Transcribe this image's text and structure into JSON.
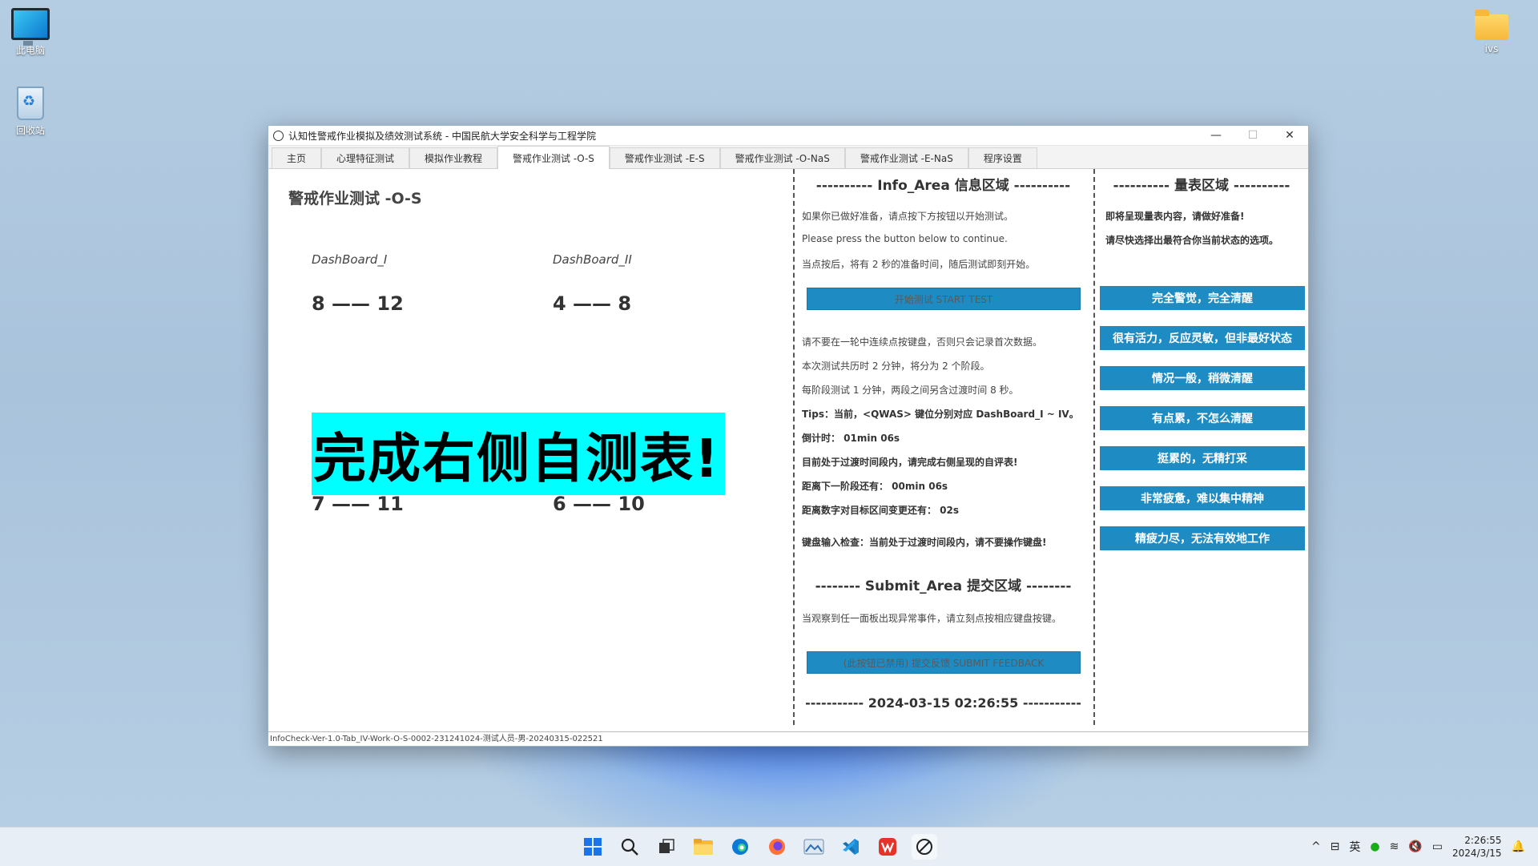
{
  "desktop": {
    "icons": [
      {
        "label": "此电脑"
      },
      {
        "label": "回收站"
      },
      {
        "label": "ivs"
      }
    ]
  },
  "window": {
    "title": "认知性警戒作业模拟及绩效测试系统 - 中国民航大学安全科学与工程学院",
    "controls": {
      "minimize": "—",
      "maximize": "☐",
      "close": "✕"
    },
    "tabs": [
      "主页",
      "心理特征测试",
      "模拟作业教程",
      "警戒作业测试 -O-S",
      "警戒作业测试 -E-S",
      "警戒作业测试 -O-NaS",
      "警戒作业测试 -E-NaS",
      "程序设置"
    ],
    "active_tab": 3
  },
  "left": {
    "title": "警戒作业测试 -O-S",
    "dashboards": [
      {
        "label": "DashBoard_I",
        "range": "8 —— 12"
      },
      {
        "label": "DashBoard_II",
        "range": "4 —— 8"
      },
      {
        "range": "7 —— 11"
      },
      {
        "range": "6 —— 10"
      }
    ],
    "banner": "完成右侧自测表!",
    "banner_color": "#00ffff"
  },
  "info": {
    "header": "---------- Info_Area  信息区域 ----------",
    "intro": [
      "如果你已做好准备，请点按下方按钮以开始测试。",
      "Please press the button below to continue.",
      "当点按后，将有 2 秒的准备时间，随后测试即刻开始。"
    ],
    "start_button": "开始测试 START TEST",
    "notes": [
      "请不要在一轮中连续点按键盘，否则只会记录首次数据。",
      "本次测试共历时 2 分钟，将分为 2 个阶段。",
      "每阶段测试 1 分钟，两段之间另含过渡时间 8 秒。"
    ],
    "tips": "Tips：当前，<QWAS> 键位分别对应 DashBoard_I ~ IV。",
    "countdown": "倒计时：  01min 06s",
    "transition": "目前处于过渡时间段内，请完成右侧呈现的自评表!",
    "next_stage": "距离下一阶段还有：  00min 06s",
    "interval_change": "距离数字对目标区间变更还有：   02s",
    "keyboard_check": "键盘输入检查：当前处于过渡时间段内，请不要操作键盘!",
    "submit_header": "-------- Submit_Area  提交区域 --------",
    "submit_hint": "当观察到任一面板出现异常事件，请立刻点按相应键盘按键。",
    "submit_button": "(此按钮已禁用) 提交反馈 SUBMIT FEEDBACK",
    "datetime": "----------- 2024-03-15 02:26:55 -----------"
  },
  "scale": {
    "header": "---------- 量表区域 ----------",
    "intro": [
      "即将呈现量表内容，请做好准备!",
      "请尽快选择出最符合你当前状态的选项。"
    ],
    "options": [
      "完全警觉，完全清醒",
      "很有活力，反应灵敏，但非最好状态",
      "情况一般，稍微清醒",
      "有点累，不怎么清醒",
      "挺累的，无精打采",
      "非常疲惫，难以集中精神",
      "精疲力尽，无法有效地工作"
    ],
    "accent": "#1e8bc3"
  },
  "statusbar": "InfoCheck-Ver-1.0-Tab_IV-Work-O-S-0002-231241024-测试人员-男-20240315-022521",
  "taskbar": {
    "apps": [
      "windows-icon",
      "search-icon",
      "task-view-icon",
      "file-explorer-icon",
      "edge-icon",
      "firefox-icon",
      "photos-icon",
      "vscode-icon",
      "wps-icon",
      "app-icon"
    ],
    "tray": {
      "chevron": "^",
      "lang": "英",
      "time": "2:26:55",
      "date": "2024/3/15"
    }
  }
}
